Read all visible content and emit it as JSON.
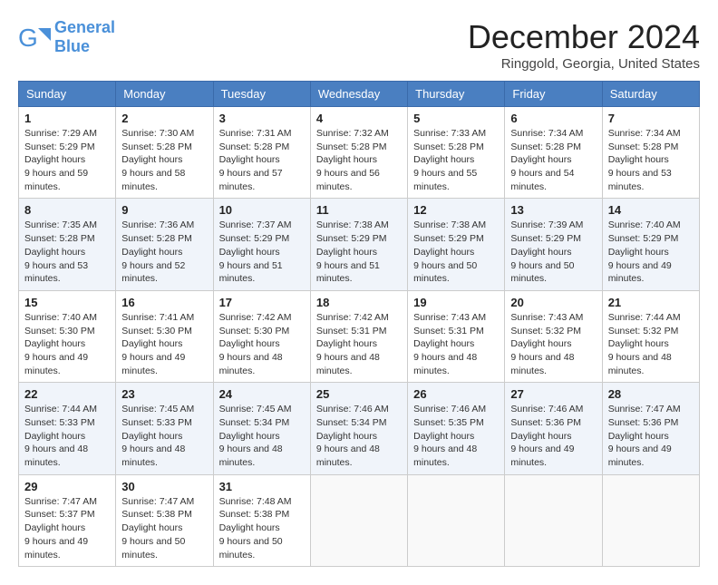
{
  "header": {
    "logo_text_general": "General",
    "logo_text_blue": "Blue",
    "month": "December 2024",
    "location": "Ringgold, Georgia, United States"
  },
  "weekdays": [
    "Sunday",
    "Monday",
    "Tuesday",
    "Wednesday",
    "Thursday",
    "Friday",
    "Saturday"
  ],
  "weeks": [
    [
      {
        "day": "1",
        "sunrise": "7:29 AM",
        "sunset": "5:29 PM",
        "daylight": "9 hours and 59 minutes."
      },
      {
        "day": "2",
        "sunrise": "7:30 AM",
        "sunset": "5:28 PM",
        "daylight": "9 hours and 58 minutes."
      },
      {
        "day": "3",
        "sunrise": "7:31 AM",
        "sunset": "5:28 PM",
        "daylight": "9 hours and 57 minutes."
      },
      {
        "day": "4",
        "sunrise": "7:32 AM",
        "sunset": "5:28 PM",
        "daylight": "9 hours and 56 minutes."
      },
      {
        "day": "5",
        "sunrise": "7:33 AM",
        "sunset": "5:28 PM",
        "daylight": "9 hours and 55 minutes."
      },
      {
        "day": "6",
        "sunrise": "7:34 AM",
        "sunset": "5:28 PM",
        "daylight": "9 hours and 54 minutes."
      },
      {
        "day": "7",
        "sunrise": "7:34 AM",
        "sunset": "5:28 PM",
        "daylight": "9 hours and 53 minutes."
      }
    ],
    [
      {
        "day": "8",
        "sunrise": "7:35 AM",
        "sunset": "5:28 PM",
        "daylight": "9 hours and 53 minutes."
      },
      {
        "day": "9",
        "sunrise": "7:36 AM",
        "sunset": "5:28 PM",
        "daylight": "9 hours and 52 minutes."
      },
      {
        "day": "10",
        "sunrise": "7:37 AM",
        "sunset": "5:29 PM",
        "daylight": "9 hours and 51 minutes."
      },
      {
        "day": "11",
        "sunrise": "7:38 AM",
        "sunset": "5:29 PM",
        "daylight": "9 hours and 51 minutes."
      },
      {
        "day": "12",
        "sunrise": "7:38 AM",
        "sunset": "5:29 PM",
        "daylight": "9 hours and 50 minutes."
      },
      {
        "day": "13",
        "sunrise": "7:39 AM",
        "sunset": "5:29 PM",
        "daylight": "9 hours and 50 minutes."
      },
      {
        "day": "14",
        "sunrise": "7:40 AM",
        "sunset": "5:29 PM",
        "daylight": "9 hours and 49 minutes."
      }
    ],
    [
      {
        "day": "15",
        "sunrise": "7:40 AM",
        "sunset": "5:30 PM",
        "daylight": "9 hours and 49 minutes."
      },
      {
        "day": "16",
        "sunrise": "7:41 AM",
        "sunset": "5:30 PM",
        "daylight": "9 hours and 49 minutes."
      },
      {
        "day": "17",
        "sunrise": "7:42 AM",
        "sunset": "5:30 PM",
        "daylight": "9 hours and 48 minutes."
      },
      {
        "day": "18",
        "sunrise": "7:42 AM",
        "sunset": "5:31 PM",
        "daylight": "9 hours and 48 minutes."
      },
      {
        "day": "19",
        "sunrise": "7:43 AM",
        "sunset": "5:31 PM",
        "daylight": "9 hours and 48 minutes."
      },
      {
        "day": "20",
        "sunrise": "7:43 AM",
        "sunset": "5:32 PM",
        "daylight": "9 hours and 48 minutes."
      },
      {
        "day": "21",
        "sunrise": "7:44 AM",
        "sunset": "5:32 PM",
        "daylight": "9 hours and 48 minutes."
      }
    ],
    [
      {
        "day": "22",
        "sunrise": "7:44 AM",
        "sunset": "5:33 PM",
        "daylight": "9 hours and 48 minutes."
      },
      {
        "day": "23",
        "sunrise": "7:45 AM",
        "sunset": "5:33 PM",
        "daylight": "9 hours and 48 minutes."
      },
      {
        "day": "24",
        "sunrise": "7:45 AM",
        "sunset": "5:34 PM",
        "daylight": "9 hours and 48 minutes."
      },
      {
        "day": "25",
        "sunrise": "7:46 AM",
        "sunset": "5:34 PM",
        "daylight": "9 hours and 48 minutes."
      },
      {
        "day": "26",
        "sunrise": "7:46 AM",
        "sunset": "5:35 PM",
        "daylight": "9 hours and 48 minutes."
      },
      {
        "day": "27",
        "sunrise": "7:46 AM",
        "sunset": "5:36 PM",
        "daylight": "9 hours and 49 minutes."
      },
      {
        "day": "28",
        "sunrise": "7:47 AM",
        "sunset": "5:36 PM",
        "daylight": "9 hours and 49 minutes."
      }
    ],
    [
      {
        "day": "29",
        "sunrise": "7:47 AM",
        "sunset": "5:37 PM",
        "daylight": "9 hours and 49 minutes."
      },
      {
        "day": "30",
        "sunrise": "7:47 AM",
        "sunset": "5:38 PM",
        "daylight": "9 hours and 50 minutes."
      },
      {
        "day": "31",
        "sunrise": "7:48 AM",
        "sunset": "5:38 PM",
        "daylight": "9 hours and 50 minutes."
      },
      null,
      null,
      null,
      null
    ]
  ]
}
